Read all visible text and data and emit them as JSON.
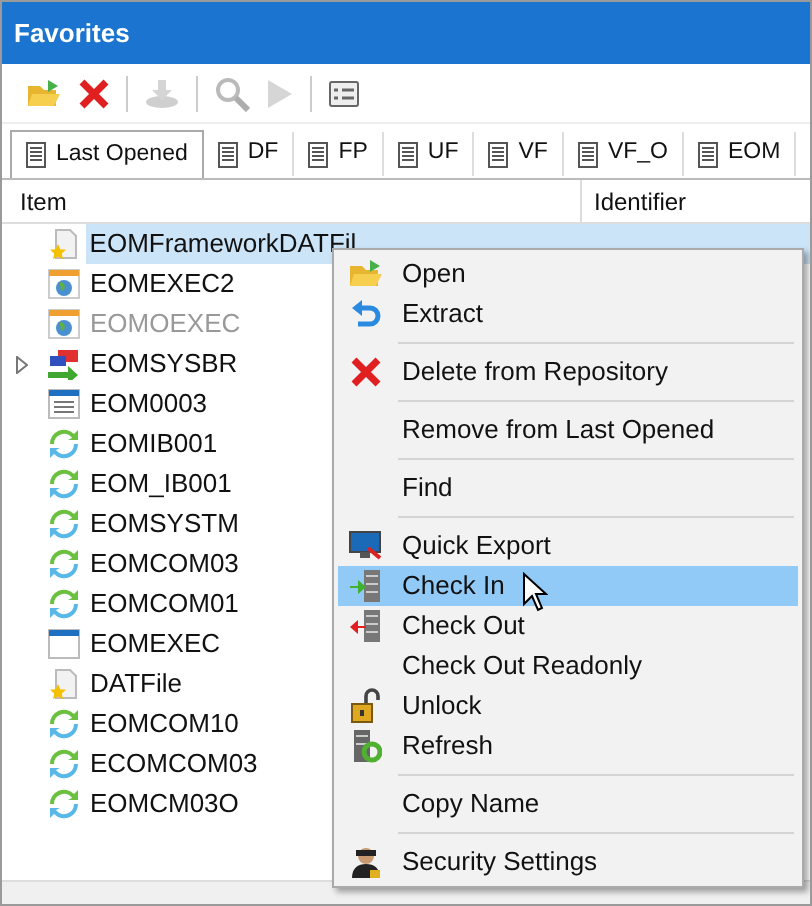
{
  "window": {
    "title": "Favorites"
  },
  "toolbar": [
    {
      "kind": "open",
      "disabled": false
    },
    {
      "kind": "delete",
      "disabled": false
    },
    {
      "kind": "sep"
    },
    {
      "kind": "download",
      "disabled": true
    },
    {
      "kind": "sep"
    },
    {
      "kind": "search",
      "disabled": true
    },
    {
      "kind": "play",
      "disabled": true
    },
    {
      "kind": "sep"
    },
    {
      "kind": "list",
      "disabled": false
    }
  ],
  "tabs": [
    {
      "label": "Last Opened",
      "selected": true
    },
    {
      "label": "DF",
      "selected": false
    },
    {
      "label": "FP",
      "selected": false
    },
    {
      "label": "UF",
      "selected": false
    },
    {
      "label": "VF",
      "selected": false
    },
    {
      "label": "VF_O",
      "selected": false
    },
    {
      "label": "EOM",
      "selected": false
    }
  ],
  "table": {
    "columns": [
      "Item",
      "Identifier"
    ],
    "rows": [
      {
        "name": "EOMFrameworkDATFil",
        "kind": "datfile",
        "selected": true,
        "disabled": false
      },
      {
        "name": "EOMEXEC2",
        "kind": "webapp",
        "selected": false,
        "disabled": false
      },
      {
        "name": "EOMOEXEC",
        "kind": "webapp",
        "selected": false,
        "disabled": true
      },
      {
        "name": "EOMSYSBR",
        "kind": "transfer",
        "selected": false,
        "disabled": false,
        "expandable": true
      },
      {
        "name": "EOM0003",
        "kind": "form",
        "selected": false,
        "disabled": false
      },
      {
        "name": "EOMIB001",
        "kind": "sync",
        "selected": false,
        "disabled": false
      },
      {
        "name": "EOM_IB001",
        "kind": "sync",
        "selected": false,
        "disabled": false
      },
      {
        "name": "EOMSYSTM",
        "kind": "sync",
        "selected": false,
        "disabled": false
      },
      {
        "name": "EOMCOM03",
        "kind": "sync",
        "selected": false,
        "disabled": false
      },
      {
        "name": "EOMCOM01",
        "kind": "sync",
        "selected": false,
        "disabled": false
      },
      {
        "name": "EOMEXEC",
        "kind": "window",
        "selected": false,
        "disabled": false
      },
      {
        "name": "DATFile",
        "kind": "datfile",
        "selected": false,
        "disabled": false
      },
      {
        "name": "EOMCOM10",
        "kind": "sync",
        "selected": false,
        "disabled": false
      },
      {
        "name": "ECOMCOM03",
        "kind": "sync",
        "selected": false,
        "disabled": false
      },
      {
        "name": "EOMCM03O",
        "kind": "sync",
        "selected": false,
        "disabled": false
      }
    ]
  },
  "context_menu": [
    {
      "kind": "open",
      "label": "Open",
      "selected": false
    },
    {
      "kind": "extract",
      "label": "Extract",
      "selected": false
    },
    {
      "kind": "separator"
    },
    {
      "kind": "delete",
      "label": "Delete from Repository",
      "selected": false
    },
    {
      "kind": "separator"
    },
    {
      "kind": "plain",
      "label": "Remove from Last Opened",
      "selected": false
    },
    {
      "kind": "separator"
    },
    {
      "kind": "plain",
      "label": "Find",
      "selected": false
    },
    {
      "kind": "separator"
    },
    {
      "kind": "export",
      "label": "Quick Export",
      "selected": false
    },
    {
      "kind": "checkin",
      "label": "Check In",
      "selected": true
    },
    {
      "kind": "checkout",
      "label": "Check Out",
      "selected": false
    },
    {
      "kind": "plain",
      "label": "Check Out Readonly",
      "selected": false
    },
    {
      "kind": "unlock",
      "label": "Unlock",
      "selected": false
    },
    {
      "kind": "refresh",
      "label": "Refresh",
      "selected": false
    },
    {
      "kind": "separator"
    },
    {
      "kind": "plain",
      "label": "Copy Name",
      "selected": false
    },
    {
      "kind": "separator"
    },
    {
      "kind": "security",
      "label": "Security Settings",
      "selected": false
    }
  ]
}
